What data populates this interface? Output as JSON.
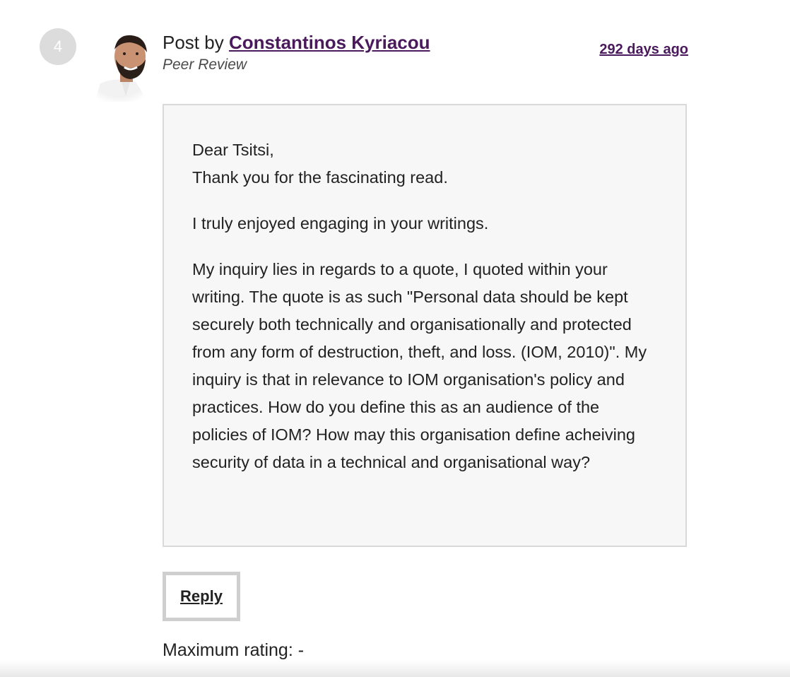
{
  "post": {
    "number": "4",
    "byline_prefix": "Post by ",
    "author": "Constantinos Kyriacou",
    "post_type": "Peer Review",
    "time_ago": "292 days ago",
    "body": {
      "greeting": "Dear Tsitsi,",
      "thanks": "Thank you for the fascinating read.",
      "paragraph_2": "I truly enjoyed engaging in your writings.",
      "paragraph_3": "My inquiry lies in regards to a quote, I quoted within your writing. The quote is as such \"Personal data should be kept securely both technically and organisationally and protected from any form of destruction, theft, and loss. (IOM, 2010)\". My inquiry is that in relevance to IOM or­ganisation's policy and practices. How do you define this as an audience of the policies of IOM? How may this or­ganisation define acheiving security of data in a technical and organisational way?"
    },
    "reply_label": "Reply",
    "rating_text": "Maximum rating: -"
  },
  "colors": {
    "link": "#4a1a5c",
    "body_background": "#f7f7f7",
    "border": "#d9d9d9",
    "number_badge": "#dcdcdc"
  },
  "icons": {
    "avatar": "user-avatar-photo"
  }
}
